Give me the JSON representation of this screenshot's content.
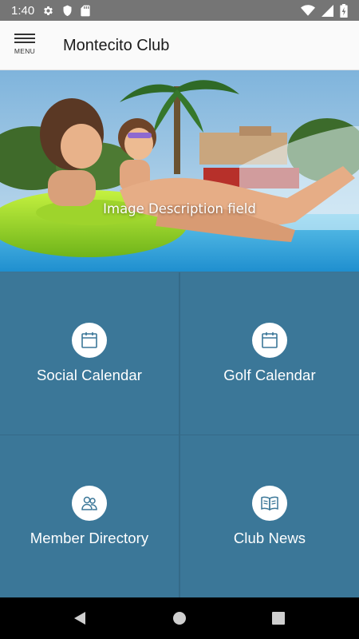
{
  "status_bar": {
    "time": "1:40",
    "left_icons": [
      "gear-icon",
      "shield-icon",
      "sd-card-icon"
    ],
    "right_icons": [
      "wifi-icon",
      "signal-icon",
      "battery-icon"
    ]
  },
  "app_bar": {
    "menu_label": "MENU",
    "title": "Montecito Club"
  },
  "hero": {
    "caption": "Image Description field"
  },
  "tiles": [
    {
      "label": "Social Calendar",
      "icon": "calendar-icon"
    },
    {
      "label": "Golf Calendar",
      "icon": "calendar-icon"
    },
    {
      "label": "Member Directory",
      "icon": "people-icon"
    },
    {
      "label": "Club News",
      "icon": "book-icon"
    }
  ],
  "colors": {
    "tile_background": "#3b7798",
    "status_bar": "#757575",
    "app_bar": "#fafafa",
    "nav_bar": "#000000"
  },
  "nav_bar": {
    "buttons": [
      "back-icon",
      "home-icon",
      "recents-icon"
    ]
  }
}
